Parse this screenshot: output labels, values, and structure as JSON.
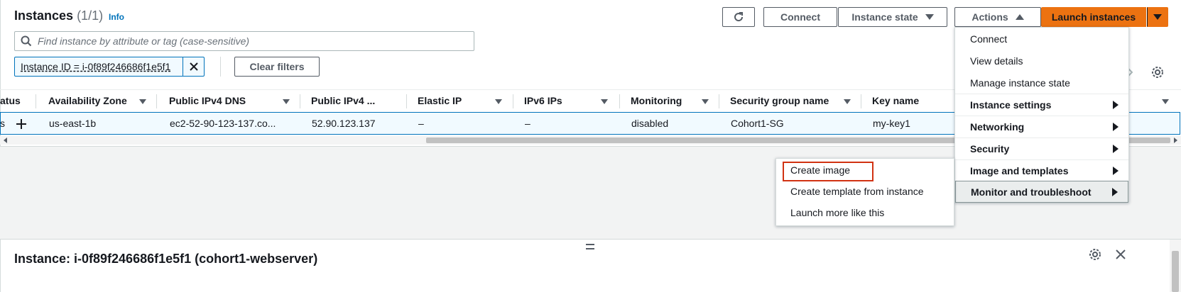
{
  "header": {
    "title": "Instances",
    "count": "(1/1)",
    "info": "Info"
  },
  "toolbar": {
    "connect": "Connect",
    "instance_state": "Instance state",
    "actions": "Actions",
    "launch": "Launch instances"
  },
  "search": {
    "placeholder": "Find instance by attribute or tag (case-sensitive)"
  },
  "filter": {
    "token": "Instance ID = i-0f89f246686f1e5f1",
    "clear": "Clear filters"
  },
  "table": {
    "columns": [
      "atus",
      "Availability Zone",
      "Public IPv4 DNS",
      "Public IPv4 ...",
      "Elastic IP",
      "IPv6 IPs",
      "Monitoring",
      "Security group name",
      "Key name"
    ],
    "row": {
      "status": "s",
      "az": "us-east-1b",
      "dns": "ec2-52-90-123-137.co...",
      "ipv4": "52.90.123.137",
      "elastic_ip": "–",
      "ipv6": "–",
      "monitoring": "disabled",
      "sg": "Cohort1-SG",
      "key": "my-key1"
    }
  },
  "actions_menu": {
    "items": [
      "Connect",
      "View details",
      "Manage instance state",
      "Instance settings",
      "Networking",
      "Security",
      "Image and templates",
      "Monitor and troubleshoot"
    ]
  },
  "submenu": {
    "items": [
      "Create image",
      "Create template from instance",
      "Launch more like this"
    ]
  },
  "detail": {
    "title": "Instance: i-0f89f246686f1e5f1 (cohort1-webserver)"
  },
  "colors": {
    "primary": "#ec7211",
    "link": "#0073bb",
    "highlight": "#d13212"
  }
}
